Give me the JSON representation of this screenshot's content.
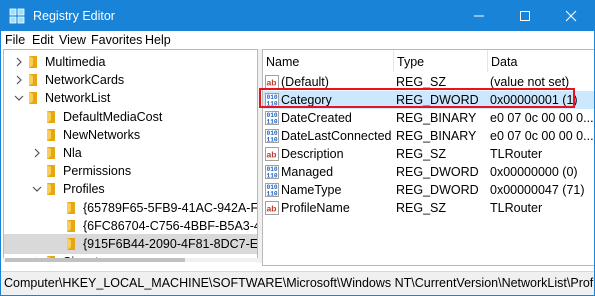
{
  "window": {
    "title": "Registry Editor",
    "accent_color": "#1883d7",
    "icons": {
      "app": "registry-editor-icon",
      "minimize": "minimize-icon",
      "maximize": "maximize-icon",
      "close": "close-icon"
    }
  },
  "menu": [
    "File",
    "Edit",
    "View",
    "Favorites",
    "Help"
  ],
  "tree": [
    {
      "label": "Multimedia",
      "expander": "collapsed",
      "depth": 1
    },
    {
      "label": "NetworkCards",
      "expander": "collapsed",
      "depth": 1
    },
    {
      "label": "NetworkList",
      "expander": "expanded",
      "depth": 1
    },
    {
      "label": "DefaultMediaCost",
      "expander": "none",
      "depth": 2
    },
    {
      "label": "NewNetworks",
      "expander": "none",
      "depth": 2
    },
    {
      "label": "Nla",
      "expander": "collapsed",
      "depth": 2
    },
    {
      "label": "Permissions",
      "expander": "none",
      "depth": 2
    },
    {
      "label": "Profiles",
      "expander": "expanded",
      "depth": 2
    },
    {
      "label": "{65789F65-5FB9-41AC-942A-F",
      "expander": "none",
      "depth": 3
    },
    {
      "label": "{6FC86704-C756-4BBF-B5A3-4",
      "expander": "none",
      "depth": 3
    },
    {
      "label": "{915F6B44-2090-4F81-8DC7-E",
      "expander": "none",
      "depth": 3,
      "selected": true
    },
    {
      "label": "Signatures",
      "expander": "collapsed",
      "depth": 2
    }
  ],
  "values_table": {
    "columns": [
      "Name",
      "Type",
      "Data"
    ],
    "highlight_color": "#e8131e",
    "rows": [
      {
        "icon": "string-value-icon",
        "name": "(Default)",
        "type": "REG_SZ",
        "data": "(value not set)"
      },
      {
        "icon": "binary-value-icon",
        "name": "Category",
        "type": "REG_DWORD",
        "data": "0x00000001 (1)",
        "selected": true
      },
      {
        "icon": "binary-value-icon",
        "name": "DateCreated",
        "type": "REG_BINARY",
        "data": "e0 07 0c 00 00 0..."
      },
      {
        "icon": "binary-value-icon",
        "name": "DateLastConnected",
        "type": "REG_BINARY",
        "data": "e0 07 0c 00 00 0..."
      },
      {
        "icon": "string-value-icon",
        "name": "Description",
        "type": "REG_SZ",
        "data": "TLRouter"
      },
      {
        "icon": "binary-value-icon",
        "name": "Managed",
        "type": "REG_DWORD",
        "data": "0x00000000 (0)"
      },
      {
        "icon": "binary-value-icon",
        "name": "NameType",
        "type": "REG_DWORD",
        "data": "0x00000047 (71)"
      },
      {
        "icon": "string-value-icon",
        "name": "ProfileName",
        "type": "REG_SZ",
        "data": "TLRouter"
      }
    ]
  },
  "status_bar": {
    "path": "Computer\\HKEY_LOCAL_MACHINE\\SOFTWARE\\Microsoft\\Windows NT\\CurrentVersion\\NetworkList\\Profiles\\{"
  }
}
